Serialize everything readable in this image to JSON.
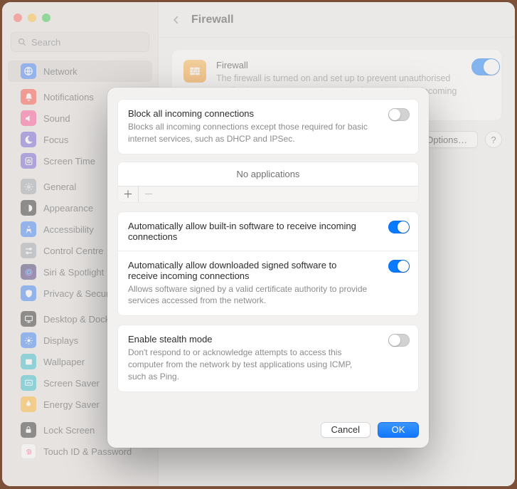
{
  "search": {
    "placeholder": "Search"
  },
  "sidebar": {
    "items": [
      {
        "label": "Network"
      },
      {
        "label": "Notifications"
      },
      {
        "label": "Sound"
      },
      {
        "label": "Focus"
      },
      {
        "label": "Screen Time"
      },
      {
        "label": "General"
      },
      {
        "label": "Appearance"
      },
      {
        "label": "Accessibility"
      },
      {
        "label": "Control Centre"
      },
      {
        "label": "Siri & Spotlight"
      },
      {
        "label": "Privacy & Security"
      },
      {
        "label": "Desktop & Dock"
      },
      {
        "label": "Displays"
      },
      {
        "label": "Wallpaper"
      },
      {
        "label": "Screen Saver"
      },
      {
        "label": "Energy Saver"
      },
      {
        "label": "Lock Screen"
      },
      {
        "label": "Touch ID & Password"
      }
    ]
  },
  "header": {
    "title": "Firewall"
  },
  "firewall_panel": {
    "title": "Firewall",
    "desc": "The firewall is turned on and set up to prevent unauthorised applications, programs and services from accepting incoming connections.",
    "options_btn": "Options…",
    "help": "?"
  },
  "modal": {
    "block_all": {
      "title": "Block all incoming connections",
      "desc": "Blocks all incoming connections except those required for basic internet services, such as DHCP and IPSec.",
      "on": false
    },
    "apps": {
      "header": "No applications",
      "plus": "＋",
      "minus": "－"
    },
    "auto_builtin": {
      "title": "Automatically allow built-in software to receive incoming connections",
      "on": true
    },
    "auto_signed": {
      "title": "Automatically allow downloaded signed software to receive incoming connections",
      "desc": "Allows software signed by a valid certificate authority to provide services accessed from the network.",
      "on": true
    },
    "stealth": {
      "title": "Enable stealth mode",
      "desc": "Don't respond to or acknowledge attempts to access this computer from the network by test applications using ICMP, such as Ping.",
      "on": false
    },
    "cancel": "Cancel",
    "ok": "OK"
  }
}
